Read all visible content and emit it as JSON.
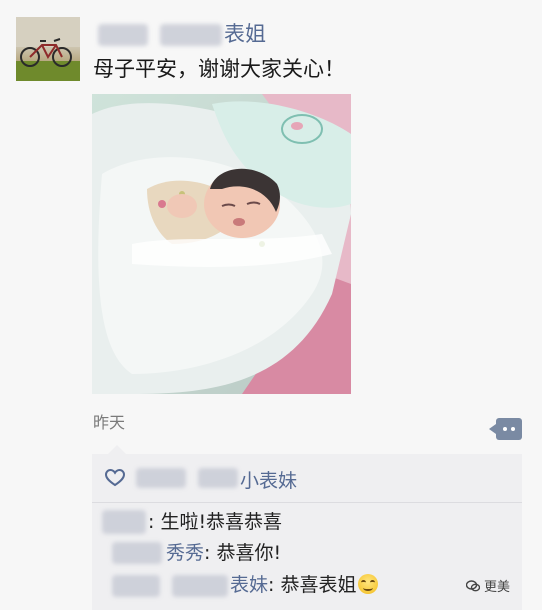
{
  "post": {
    "author_name_suffix": "表姐",
    "text": "母子平安，谢谢大家关心！",
    "timestamp": "昨天",
    "photo_subject": "newborn-baby-in-blanket"
  },
  "likes": {
    "names": [
      "小表妹"
    ]
  },
  "comments": [
    {
      "author": "",
      "text": ": 生啦!恭喜恭喜"
    },
    {
      "author": "秀秀",
      "text": ": 恭喜你!"
    },
    {
      "author": "表妹",
      "text": ": 恭喜表姐"
    }
  ],
  "icons": {
    "comment": "comment-bubble-icon",
    "like": "heart-icon",
    "emoji": "smile-emoji-icon",
    "watermark": "wechat-logo-icon"
  },
  "watermark": {
    "label": "更美"
  },
  "colors": {
    "link": "#556a93",
    "panel": "#efeff1",
    "background": "#f7f7f7"
  }
}
